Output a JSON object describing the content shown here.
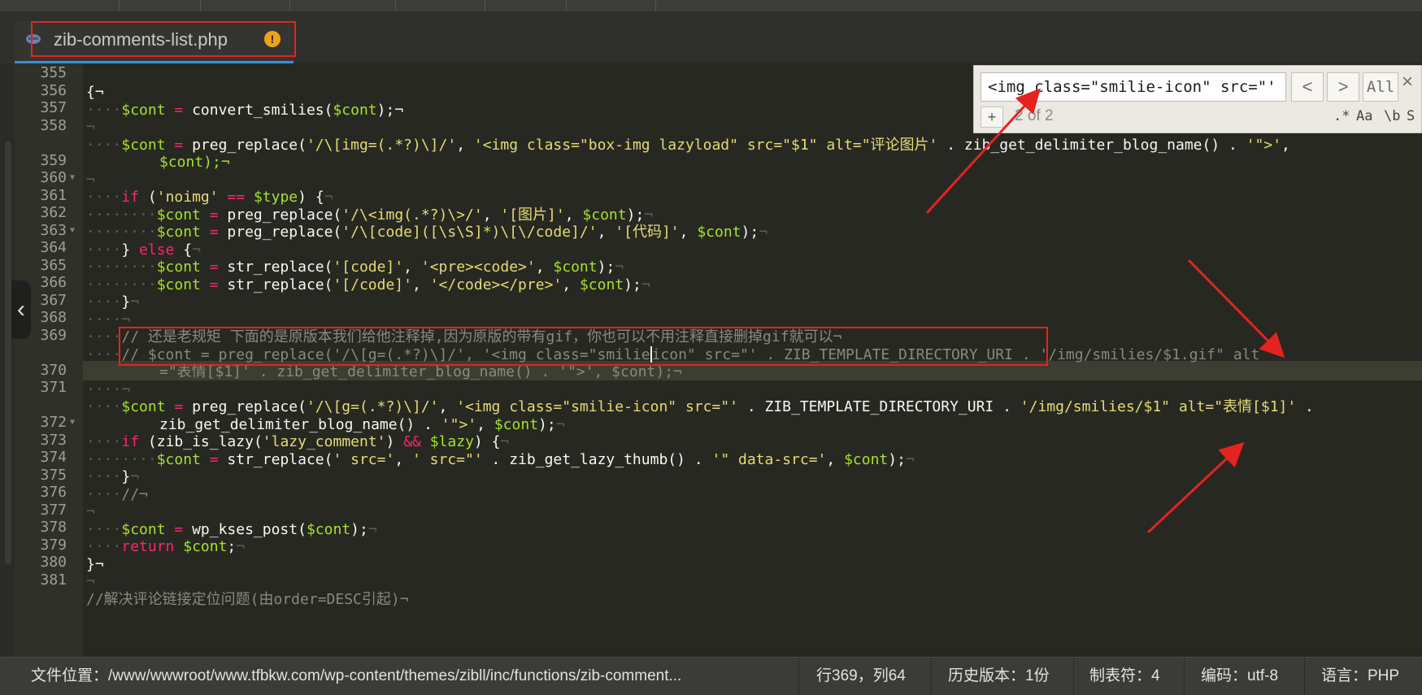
{
  "tab": {
    "filename": "zib-comments-list.php",
    "warning": "!"
  },
  "search": {
    "query": "<img class=\"smilie-icon\" src=\"'",
    "prev": "<",
    "next": ">",
    "all": "All",
    "close": "×",
    "add": "+",
    "counter": "2 of 2",
    "opt_regex": ".*",
    "opt_case": "Aa",
    "opt_word": "\\b",
    "opt_s": "S"
  },
  "lines": [
    {
      "n": "355",
      "fold": false
    },
    {
      "n": "356",
      "fold": false
    },
    {
      "n": "357",
      "fold": false
    },
    {
      "n": "358",
      "fold": false
    },
    {
      "n": "",
      "fold": false
    },
    {
      "n": "359",
      "fold": false
    },
    {
      "n": "360",
      "fold": true
    },
    {
      "n": "361",
      "fold": false
    },
    {
      "n": "362",
      "fold": false
    },
    {
      "n": "363",
      "fold": true
    },
    {
      "n": "364",
      "fold": false
    },
    {
      "n": "365",
      "fold": false
    },
    {
      "n": "366",
      "fold": false
    },
    {
      "n": "367",
      "fold": false
    },
    {
      "n": "368",
      "fold": false
    },
    {
      "n": "369",
      "fold": false
    },
    {
      "n": "",
      "fold": false
    },
    {
      "n": "370",
      "fold": false
    },
    {
      "n": "371",
      "fold": false
    },
    {
      "n": "",
      "fold": false
    },
    {
      "n": "372",
      "fold": true
    },
    {
      "n": "373",
      "fold": false
    },
    {
      "n": "374",
      "fold": false
    },
    {
      "n": "375",
      "fold": false
    },
    {
      "n": "376",
      "fold": false
    },
    {
      "n": "377",
      "fold": false
    },
    {
      "n": "378",
      "fold": false
    },
    {
      "n": "379",
      "fold": false
    },
    {
      "n": "380",
      "fold": false
    },
    {
      "n": "381",
      "fold": false
    }
  ],
  "code": {
    "l355": "{¬",
    "l356_var": "$cont",
    "l356_fn": "convert_smilies(",
    "l356_end": ");¬",
    "l358_var": "$cont",
    "l358_fn": "preg_replace(",
    "l358_s1": "'/\\[img=(.*?)\\]/'",
    "l358_s2": "'<img class=\"box-img lazyload\" src=\"$1\" alt=\"评论图片'",
    "l358_fn2": "zib_get_delimiter_blog_name()",
    "l358_s3": "'\">'",
    "l358b": "$cont);¬",
    "l360_kw": "if",
    "l360_s": "'noimg'",
    "l360_var": "$type",
    "l361_fn": "preg_replace(",
    "l361_s1": "'/\\<img(.*?)\\>/'",
    "l361_s2": "'[图片]'",
    "l362_s1": "'/\\[code]([\\s\\S]*)\\[\\/code]/'",
    "l362_s2": "'[代码]'",
    "l363_kw": "else",
    "l364_fn": "str_replace(",
    "l364_s1": "'[code]'",
    "l364_s2": "'<pre><code>'",
    "l365_s1": "'[/code]'",
    "l365_s2": "'</code></pre>'",
    "l368": "// 还是老规矩 下面的是原版本我们给他注释掉,因为原版的带有gif，你也可以不用注释直接删掉gif就可以¬",
    "l369a": "// $cont = preg_replace('/\\[g=(.*?)\\]/', '<img class=\"smilie",
    "l369b": "icon\" src=\"' . ZIB_TEMPLATE_DIRECTORY_URI . '/img/smilies/$1.gif\" alt",
    "l369c": "=\"表情[$1]' . zib_get_delimiter_blog_name() . '\">', $cont);¬",
    "l371_s1": "'/\\[g=(.*?)\\]/'",
    "l371_s2": "'<img class=\"smilie-icon\" src=\"'",
    "l371_const": "ZIB_TEMPLATE_DIRECTORY_URI",
    "l371_s3": "'/img/smilies/$1\" alt=\"表情[$1]'",
    "l371b_fn": "zib_get_delimiter_blog_name()",
    "l371b_s": "'\">'",
    "l372_fn": "zib_is_lazy(",
    "l372_s": "'lazy_comment'",
    "l372_var": "$lazy",
    "l373_s1": "' src='",
    "l373_s2": "' src=\"'",
    "l373_fn2": "zib_get_lazy_thumb()",
    "l373_s3": "'\" data-src='",
    "l375": "//¬",
    "l377_fn": "wp_kses_post(",
    "l378_kw": "return",
    "l379": "}¬",
    "l381": "//解决评论链接定位问题(由order=DESC引起)¬"
  },
  "status": {
    "path": "文件位置：/www/wwwroot/www.tfbkw.com/wp-content/themes/zibll/inc/functions/zib-comment...",
    "position": "行369，列64",
    "history": "历史版本：1份",
    "tab": "制表符：4",
    "encoding": "编码：utf-8",
    "language": "语言：PHP"
  },
  "colors": {
    "background": "#272822",
    "keyword": "#f92672",
    "variable": "#a6e22e",
    "string": "#e6db74",
    "comment": "#888a7b",
    "annotation": "#e52320"
  }
}
